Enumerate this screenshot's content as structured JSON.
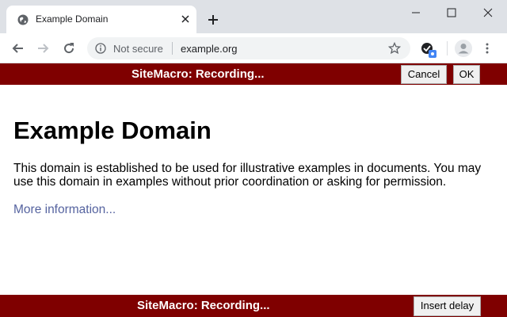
{
  "browser": {
    "tab_title": "Example Domain",
    "security_label": "Not secure",
    "url": "example.org"
  },
  "recorder": {
    "top_status": "SiteMacro: Recording...",
    "cancel_label": "Cancel",
    "ok_label": "OK",
    "bottom_status": "SiteMacro: Recording...",
    "insert_delay_label": "Insert delay",
    "bar_color": "#7f0000"
  },
  "page": {
    "heading": "Example Domain",
    "paragraph": "This domain is established to be used for illustrative examples in documents. You may use this domain in examples without prior coordination or asking for permission.",
    "more_link": "More information..."
  },
  "icons": [
    "globe-icon",
    "close-icon",
    "plus-icon",
    "minimize-icon",
    "maximize-icon",
    "window-close-icon",
    "back-arrow-icon",
    "forward-arrow-icon",
    "reload-icon",
    "info-icon",
    "star-icon",
    "extension-icon",
    "avatar-icon",
    "menu-icon"
  ]
}
